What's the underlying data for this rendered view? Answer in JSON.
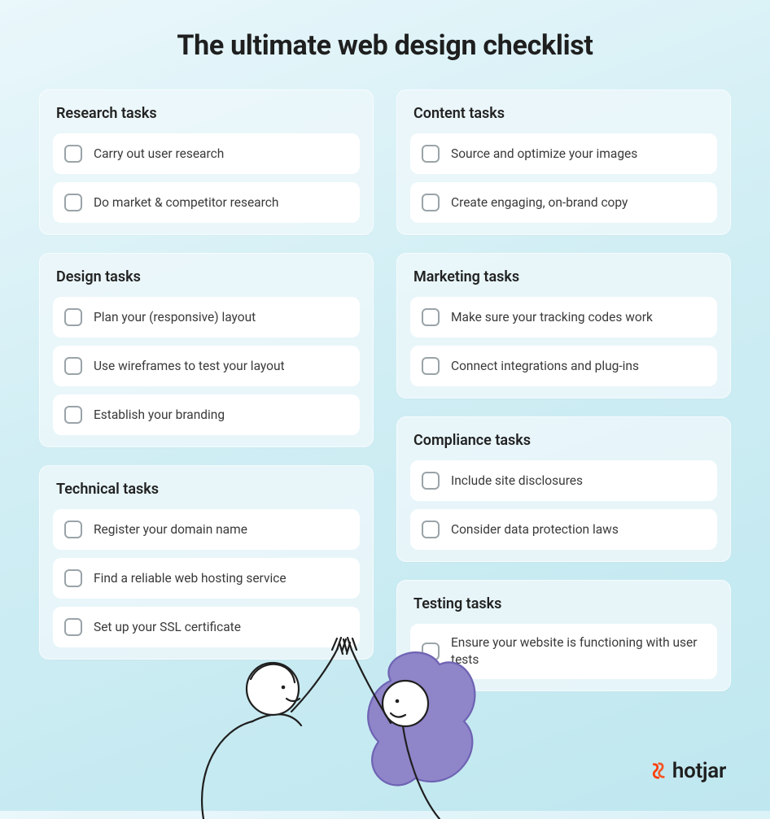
{
  "title": "The ultimate web design checklist",
  "left": [
    {
      "title": "Research tasks",
      "items": [
        "Carry out user research",
        "Do market & competitor research"
      ]
    },
    {
      "title": "Design tasks",
      "items": [
        "Plan your (responsive) layout",
        "Use wireframes to test your layout",
        "Establish your branding"
      ]
    },
    {
      "title": "Technical tasks",
      "items": [
        "Register your domain name",
        "Find a reliable web hosting service",
        "Set up your SSL certificate"
      ]
    }
  ],
  "right": [
    {
      "title": "Content tasks",
      "items": [
        "Source and optimize your images",
        "Create engaging, on-brand copy"
      ]
    },
    {
      "title": "Marketing tasks",
      "items": [
        "Make sure your tracking codes work",
        "Connect integrations and plug-ins"
      ]
    },
    {
      "title": "Compliance tasks",
      "items": [
        "Include site disclosures",
        "Consider data protection laws"
      ]
    },
    {
      "title": "Testing tasks",
      "items": [
        "Ensure your website is functioning with user tests"
      ]
    }
  ],
  "brand": "hotjar"
}
